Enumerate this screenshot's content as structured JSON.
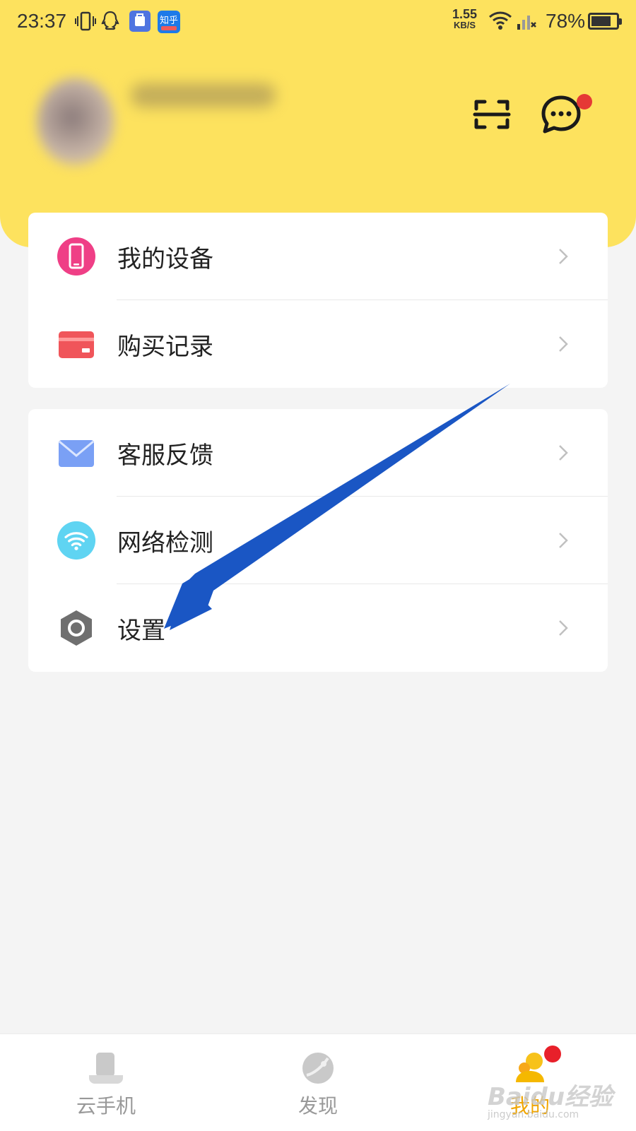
{
  "status_bar": {
    "time": "23:37",
    "net_speed_value": "1.55",
    "net_speed_unit": "KB/S",
    "battery_percent": "78%",
    "battery_level": 0.78,
    "notification_icons": [
      "vibrate-icon",
      "qq-icon",
      "store-icon",
      "zhihu-icon"
    ],
    "zhihu_label": "知乎"
  },
  "header": {
    "scan_icon": "scan-icon",
    "message_icon": "message-icon",
    "message_badge": true,
    "accent_color": "#fde25e"
  },
  "menu_group_1": [
    {
      "label": "我的设备",
      "icon": "phone-icon",
      "color": "#ef3f86"
    },
    {
      "label": "购买记录",
      "icon": "card-icon",
      "color": "#f0555a"
    }
  ],
  "menu_group_2": [
    {
      "label": "客服反馈",
      "icon": "mail-icon",
      "color": "#7aa0f5"
    },
    {
      "label": "网络检测",
      "icon": "wifi-icon",
      "color": "#5fd4f2"
    },
    {
      "label": "设置",
      "icon": "gear-icon",
      "color": "#6f6f6f"
    }
  ],
  "annotation": {
    "color": "#1a56c4"
  },
  "tab_bar": {
    "tabs": [
      {
        "label": "云手机",
        "icon": "cloud-phone-icon",
        "active": false
      },
      {
        "label": "发现",
        "icon": "discover-icon",
        "active": false
      },
      {
        "label": "我的",
        "icon": "me-icon",
        "active": true,
        "badge": true
      }
    ],
    "active_color": "#f0a500"
  },
  "watermark": {
    "brand": "Baidu经验",
    "url": "jingyan.baidu.com"
  }
}
